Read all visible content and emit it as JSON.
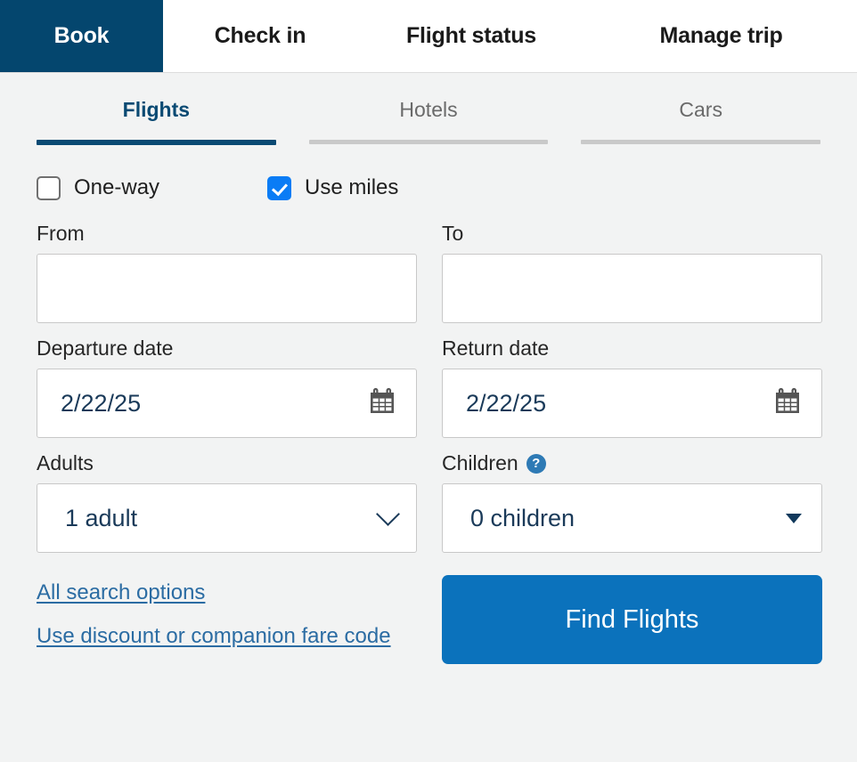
{
  "topnav": {
    "tabs": [
      {
        "label": "Book",
        "active": true
      },
      {
        "label": "Check in",
        "active": false
      },
      {
        "label": "Flight status",
        "active": false
      },
      {
        "label": "Manage trip",
        "active": false
      }
    ],
    "active_bg": "#04466e"
  },
  "subtabs": [
    {
      "label": "Flights",
      "active": true
    },
    {
      "label": "Hotels",
      "active": false
    },
    {
      "label": "Cars",
      "active": false
    }
  ],
  "options": {
    "oneway": {
      "label": "One-way",
      "checked": false
    },
    "use_miles": {
      "label": "Use miles",
      "checked": true
    }
  },
  "fields": {
    "from": {
      "label": "From",
      "value": "",
      "placeholder": ""
    },
    "to": {
      "label": "To",
      "value": "",
      "placeholder": ""
    },
    "departure_date": {
      "label": "Departure date",
      "value": "2/22/25",
      "icon": "calendar-icon"
    },
    "return_date": {
      "label": "Return date",
      "value": "2/22/25",
      "icon": "calendar-icon"
    },
    "adults": {
      "label": "Adults",
      "value": "1 adult",
      "icon": "chevron-down-icon"
    },
    "children": {
      "label": "Children",
      "value": "0 children",
      "icon": "caret-down-icon",
      "help": "?"
    }
  },
  "links": {
    "all_search_options": "All search options",
    "discount_code": "Use discount or companion fare code"
  },
  "actions": {
    "find_flights": "Find Flights"
  },
  "colors": {
    "navy": "#04466e",
    "link_blue": "#2b6ca3",
    "button_blue": "#0b72bc",
    "checkbox_blue": "#0a7cf5",
    "page_bg": "#f2f3f3"
  }
}
